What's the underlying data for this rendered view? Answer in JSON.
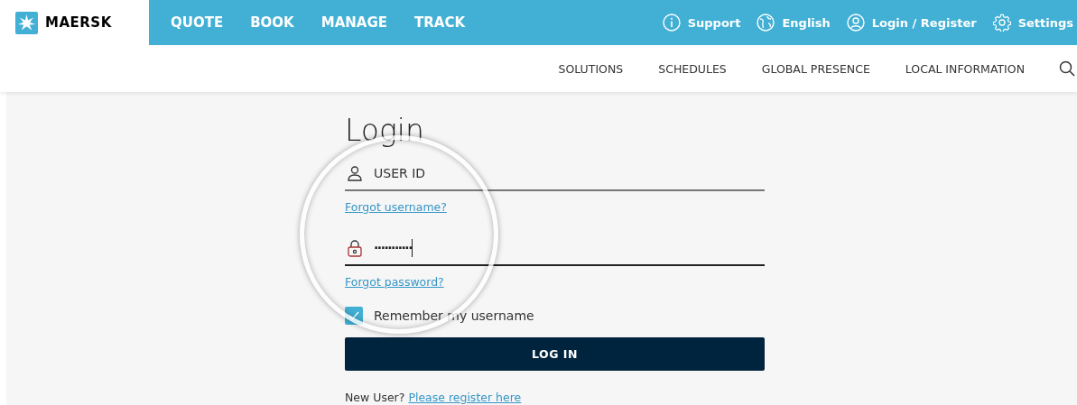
{
  "brand": {
    "name": "MAERSK"
  },
  "main_nav": [
    {
      "label": "QUOTE"
    },
    {
      "label": "BOOK"
    },
    {
      "label": "MANAGE"
    },
    {
      "label": "TRACK"
    }
  ],
  "utility_nav": [
    {
      "kind": "info",
      "label": "Support"
    },
    {
      "kind": "globe",
      "label": "English"
    },
    {
      "kind": "user",
      "label": "Login / Register"
    },
    {
      "kind": "gear",
      "label": "Settings"
    }
  ],
  "sub_nav": [
    {
      "label": "SOLUTIONS"
    },
    {
      "label": "SCHEDULES"
    },
    {
      "label": "GLOBAL PRESENCE"
    },
    {
      "label": "LOCAL INFORMATION"
    }
  ],
  "login": {
    "title": "Login",
    "username": {
      "placeholder": "USER ID"
    },
    "forgot_username": "Forgot username?",
    "password": {
      "value": "···········"
    },
    "forgot_password": "Forgot password?",
    "remember": {
      "label": "Remember my username",
      "checked": true
    },
    "submit": "LOG IN",
    "new_user": {
      "text": "New User?",
      "link": "Please register here"
    }
  }
}
